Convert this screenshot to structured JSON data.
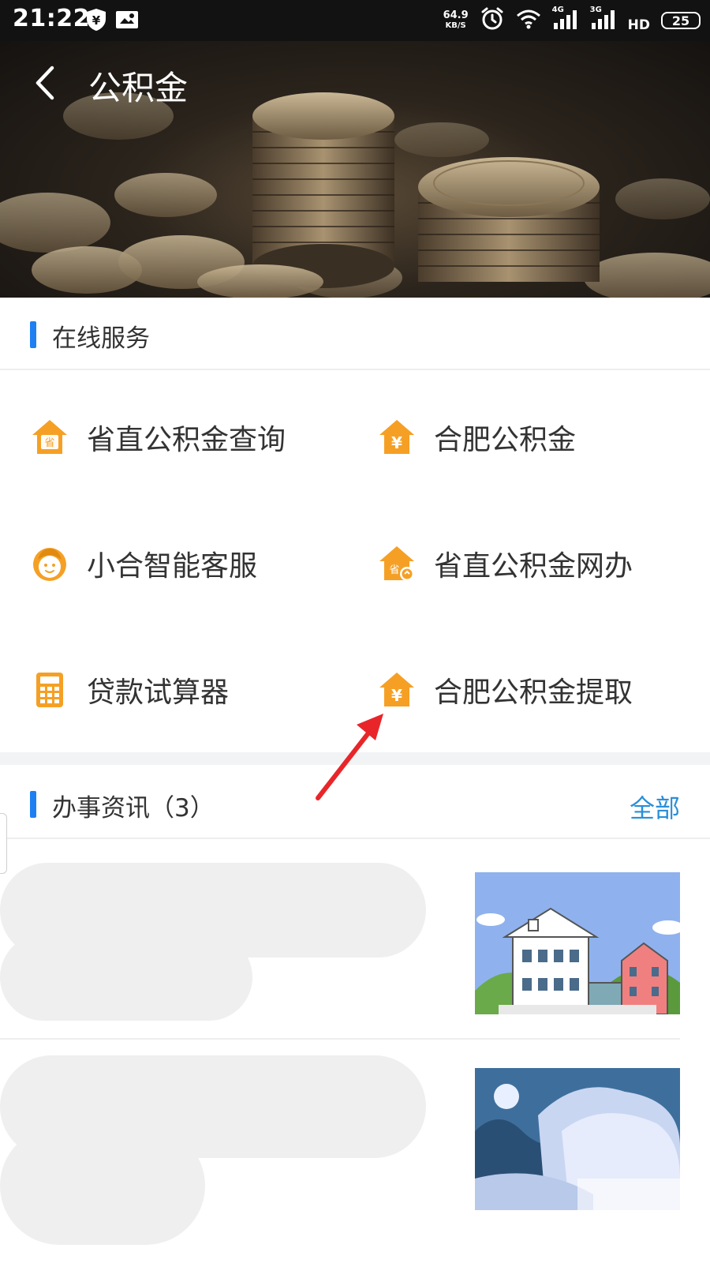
{
  "status_bar": {
    "time": "21:22",
    "net_speed_value": "64.9",
    "net_speed_unit": "KB/S",
    "signal1_label": "4G",
    "signal2_label": "3G",
    "hd_label": "HD",
    "battery": "25"
  },
  "header": {
    "title": "公积金"
  },
  "online_services": {
    "title": "在线服务",
    "items": [
      {
        "label": "省直公积金查询",
        "icon": "house-sheng-icon"
      },
      {
        "label": "合肥公积金",
        "icon": "house-yuan-icon"
      },
      {
        "label": "小合智能客服",
        "icon": "assistant-face-icon"
      },
      {
        "label": "省直公积金网办",
        "icon": "house-online-icon"
      },
      {
        "label": "贷款试算器",
        "icon": "calculator-icon"
      },
      {
        "label": "合肥公积金提取",
        "icon": "house-yuan-icon"
      }
    ]
  },
  "news": {
    "title": "办事资讯（3）",
    "view_all": "全部"
  },
  "colors": {
    "accent_blue": "#1e7ff2",
    "link_blue": "#2a8fd8",
    "icon_orange": "#f5a025",
    "annotation_red": "#e8262a"
  }
}
